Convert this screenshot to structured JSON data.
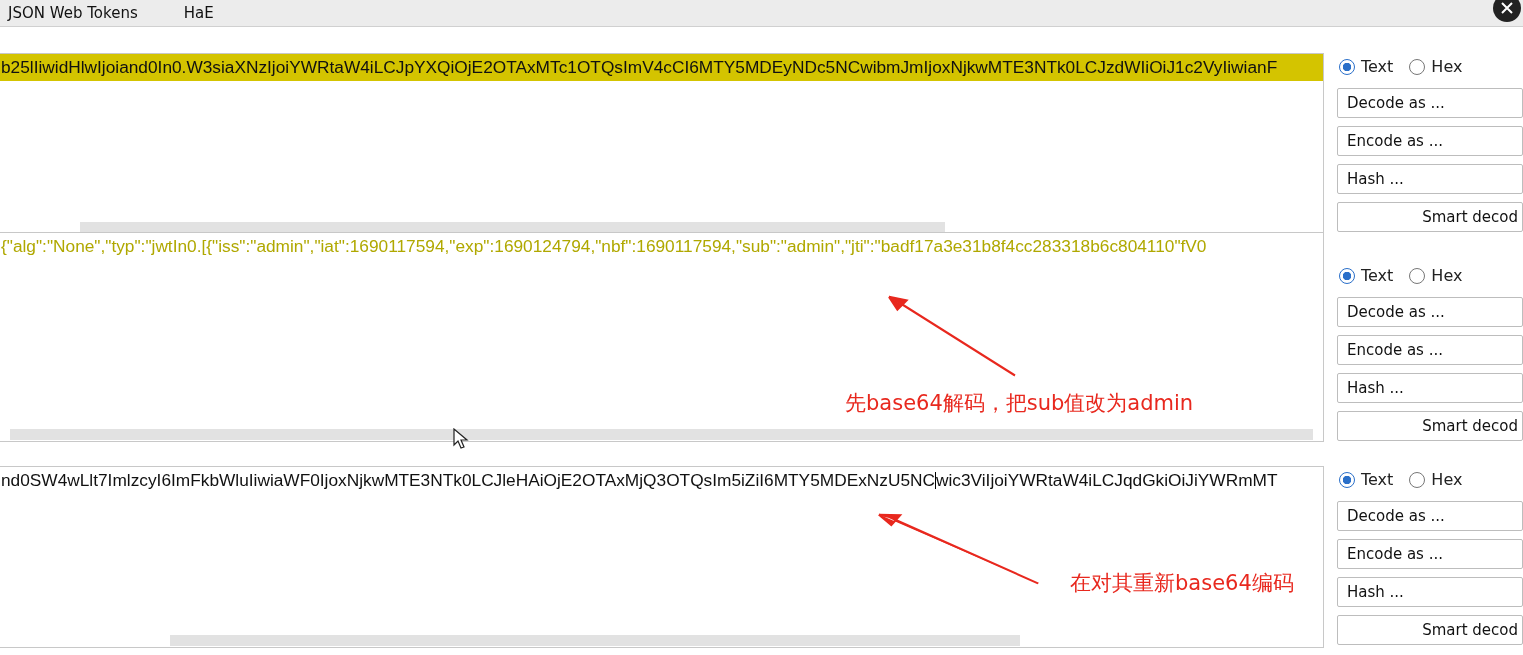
{
  "tabs": [
    {
      "label": "JSON Web Tokens"
    },
    {
      "label": "HaE"
    }
  ],
  "panels": [
    {
      "kind": "encoded",
      "highlighted": true,
      "text": "b25lIiwidHlwIjoiand0In0.W3siaXNzIjoiYWRtaW4iLCJpYXQiOjE2OTAxMTc1OTQsImV4cCI6MTY5MDEyNDc5NCwibmJmIjoxNjkwMTE3NTk0LCJzdWIiOiJ1c2VyIiwianF",
      "caret": false,
      "modes": [
        {
          "label": "Text",
          "selected": true
        },
        {
          "label": "Hex",
          "selected": false
        }
      ],
      "buttons": [
        "Decode as ...",
        "Encode as ...",
        "Hash ...",
        "Smart decod"
      ]
    },
    {
      "kind": "decoded",
      "highlighted": false,
      "text": "{\"alg\":\"None\",\"typ\":\"jwtIn0.[{\"iss\":\"admin\",\"iat\":1690117594,\"exp\":1690124794,\"nbf\":1690117594,\"sub\":\"admin\",\"jti\":\"badf17a3e31b8f4cc283318b6c804110\"fV0",
      "caret": false,
      "modes": [
        {
          "label": "Text",
          "selected": true
        },
        {
          "label": "Hex",
          "selected": false
        }
      ],
      "buttons": [
        "Decode as ...",
        "Encode as ...",
        "Hash ...",
        "Smart decod"
      ],
      "annotation": "先base64解码，把sub值改为admin"
    },
    {
      "kind": "encoded",
      "highlighted": false,
      "text": "nd0SW4wLlt7ImlzcyI6ImFkbWluIiwiaWF0IjoxNjkwMTE3NTk0LCJleHAiOjE2OTAxMjQ3OTQsIm5iZiI6MTY5MDExNzU5NC",
      "caret": true,
      "text_after_caret": "wic3ViIjoiYWRtaW4iLCJqdGkiOiJiYWRmMT",
      "modes": [
        {
          "label": "Text",
          "selected": true
        },
        {
          "label": "Hex",
          "selected": false
        }
      ],
      "buttons": [
        "Decode as ...",
        "Encode as ...",
        "Hash ...",
        "Smart decod"
      ],
      "annotation": "在对其重新base64编码"
    }
  ]
}
